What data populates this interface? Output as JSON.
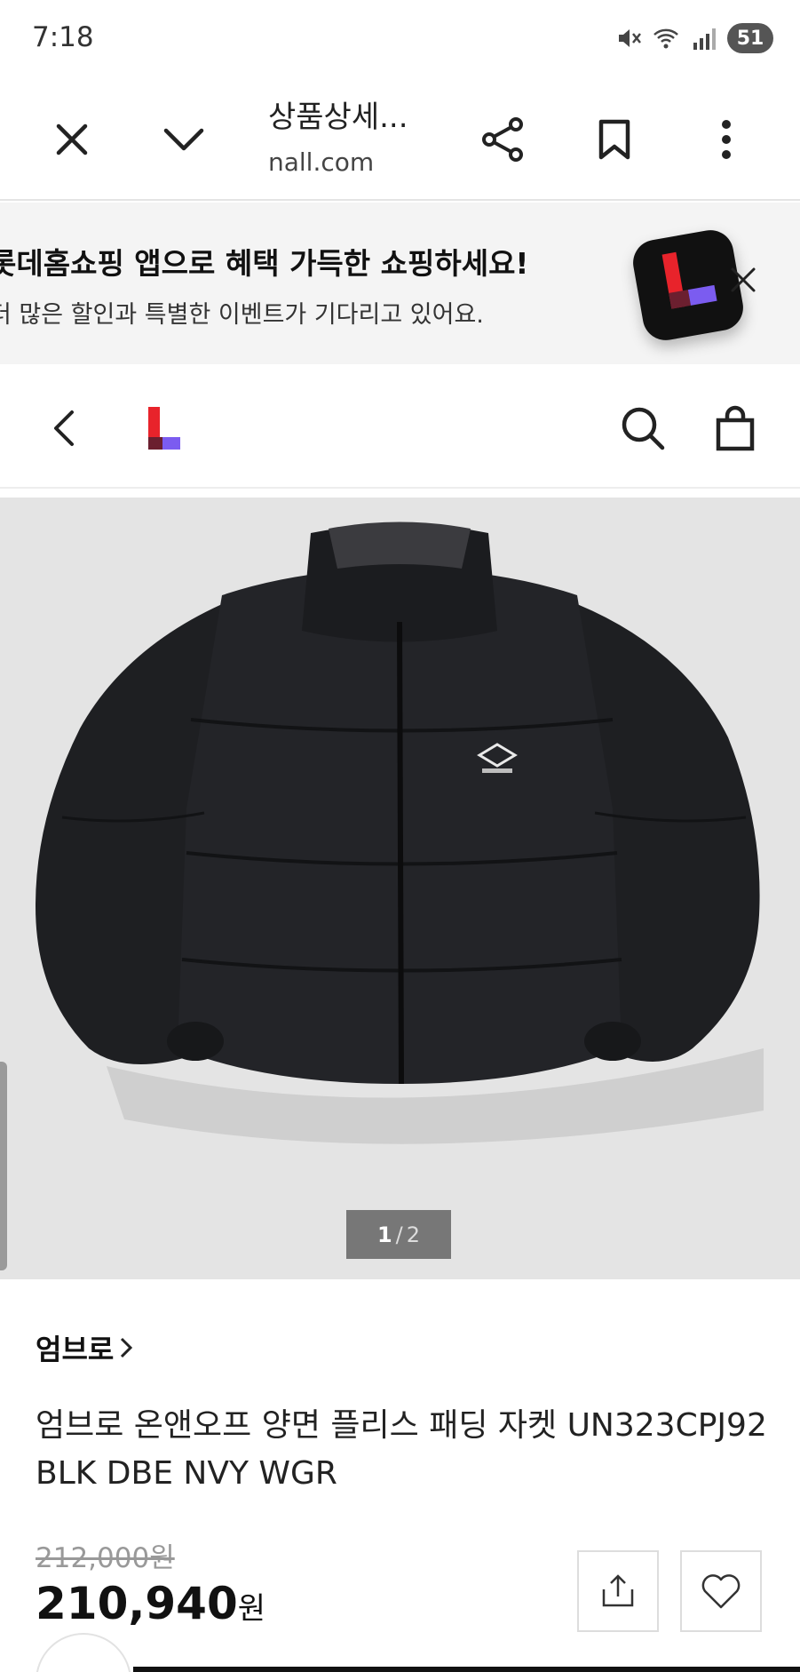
{
  "status_bar": {
    "time": "7:18",
    "battery": "51",
    "icons": [
      "mute-icon",
      "wifi-icon",
      "signal-icon",
      "battery-icon"
    ]
  },
  "browser": {
    "title": "상품상세...",
    "url": "nall.com",
    "buttons": [
      "close-icon",
      "chevron-down-icon",
      "share-icon",
      "bookmark-icon",
      "more-vertical-icon"
    ]
  },
  "app_banner": {
    "title": "롯데홈쇼핑 앱으로 혜택 가득한 쇼핑하세요!",
    "subtitle": "더 많은 할인과 특별한 이벤트가 기다리고 있어요.",
    "colors": {
      "logo_red": "#e8232b",
      "logo_purple": "#7b5cf0",
      "logo_bg": "#111111"
    }
  },
  "site_header": {
    "icons": [
      "back-chevron-icon",
      "lotte-logo-icon",
      "search-icon",
      "shopping-bag-icon"
    ]
  },
  "gallery": {
    "current": "1",
    "separator": "/",
    "total": "2"
  },
  "product": {
    "brand": "엄브로",
    "name": "엄브로 온앤오프 양면 플리스 패딩 자켓 UN323CPJ92 BLK DBE NVY WGR",
    "original_price": "212,000원",
    "sale_price": "210,940",
    "currency": "원"
  },
  "colors": {
    "accent_red": "#e8232b",
    "accent_purple": "#7b5cf0"
  }
}
